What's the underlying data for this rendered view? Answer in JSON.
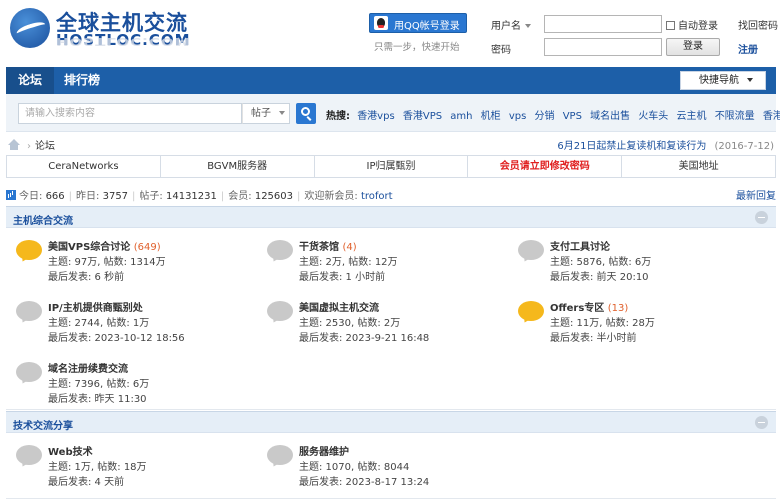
{
  "header": {
    "logo_cn": "全球主机交流",
    "logo_en": "HOSTLOC.COM",
    "qq_login_label": "用QQ帐号登录",
    "qq_tip": "只需一步，快速开始",
    "username_label": "用户名",
    "password_label": "密码",
    "username_value": "",
    "password_value": "",
    "auto_login_label": "自动登录",
    "find_password_label": "找回密码",
    "login_button_label": "登录",
    "register_label": "注册"
  },
  "nav": {
    "items": [
      {
        "label": "论坛"
      },
      {
        "label": "排行榜"
      }
    ],
    "quick_nav_label": "快捷导航"
  },
  "search": {
    "placeholder": "请输入搜索内容",
    "type_label": "帖子",
    "hot_label": "热搜:",
    "hot_keywords": [
      "香港vps",
      "香港VPS",
      "amh",
      "机柜",
      "vps",
      "分销",
      "VPS",
      "域名出售",
      "火车头",
      "云主机",
      "不限流量",
      "香港服务器"
    ]
  },
  "breadcrumb": {
    "home_sep": "›",
    "current": "论坛"
  },
  "notice": {
    "text": "6月21日起禁止复读机和复读行为",
    "date": "(2016-7-12)"
  },
  "link_strip": [
    {
      "label": "CeraNetworks"
    },
    {
      "label": "BGVM服务器"
    },
    {
      "label": "IP归属甄别"
    },
    {
      "label": "会员请立即修改密码"
    },
    {
      "label": "美国地址"
    }
  ],
  "stats": {
    "today_label": "今日:",
    "today": "666",
    "yesterday_label": "昨日:",
    "yesterday": "3757",
    "posts_label": "帖子:",
    "posts": "14131231",
    "members_label": "会员:",
    "members": "125603",
    "welcome_label": "欢迎新会员:",
    "new_member": "trofort",
    "latest_reply_label": "最新回复"
  },
  "categories": [
    {
      "title": "主机综合交流",
      "forums": [
        {
          "name": "美国VPS综合讨论",
          "today": "(649)",
          "stats": "主题: 97万, 帖数: 1314万",
          "last": "最后发表: 6 秒前",
          "new": true
        },
        {
          "name": "干货茶馆",
          "today": "(4)",
          "stats": "主题: 2万, 帖数: 12万",
          "last": "最后发表: 1 小时前",
          "new": false
        },
        {
          "name": "支付工具讨论",
          "today": "",
          "stats": "主题: 5876, 帖数: 6万",
          "last": "最后发表: 前天 20:10",
          "new": false
        },
        {
          "name": "IP/主机提供商甄别处",
          "today": "",
          "stats": "主题: 2744, 帖数: 1万",
          "last": "最后发表: 2023-10-12 18:56",
          "new": false
        },
        {
          "name": "美国虚拟主机交流",
          "today": "",
          "stats": "主题: 2530, 帖数: 2万",
          "last": "最后发表: 2023-9-21 16:48",
          "new": false
        },
        {
          "name": "Offers专区",
          "today": "(13)",
          "stats": "主题: 11万, 帖数: 28万",
          "last": "最后发表: 半小时前",
          "new": true
        },
        {
          "name": "域名注册续费交流",
          "today": "",
          "stats": "主题: 7396, 帖数: 6万",
          "last": "最后发表: 昨天 11:30",
          "new": false
        }
      ]
    },
    {
      "title": "技术交流分享",
      "forums": [
        {
          "name": "Web技术",
          "today": "",
          "stats": "主题: 1万, 帖数: 18万",
          "last": "最后发表: 4 天前",
          "new": false
        },
        {
          "name": "服务器维护",
          "today": "",
          "stats": "主题: 1070, 帖数: 8044",
          "last": "最后发表: 2023-8-17 13:24",
          "new": false
        }
      ]
    }
  ]
}
